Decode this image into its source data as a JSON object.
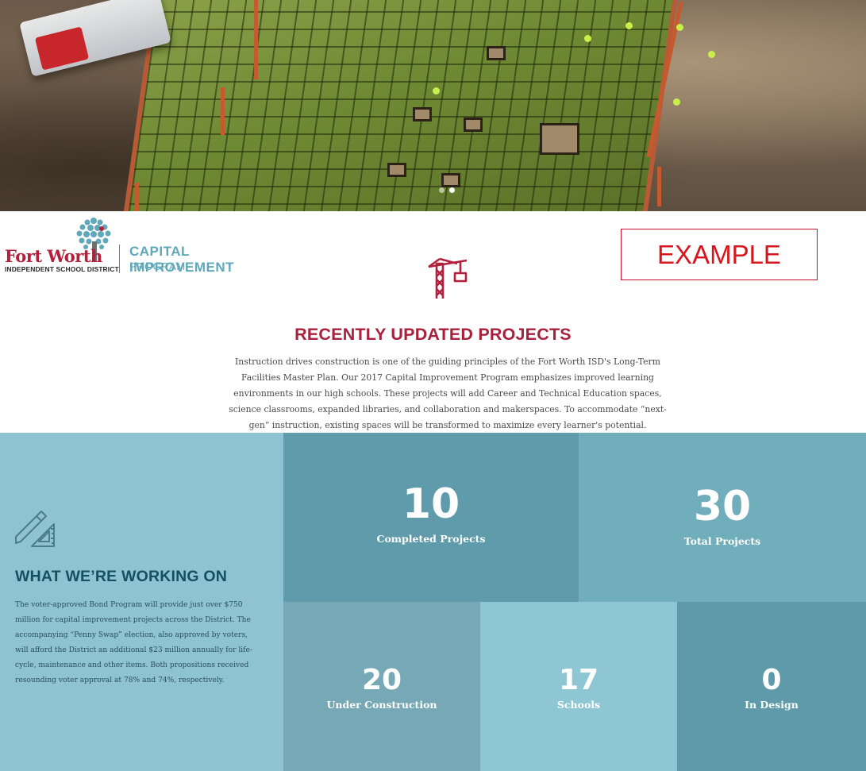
{
  "hero": {
    "image_icon": "construction-site-aerial-photo",
    "slide_count": 2,
    "active_slide": 2
  },
  "logo": {
    "district_name": "Fort Worth",
    "district_subtitle": "INDEPENDENT SCHOOL DISTRICT",
    "program_title": "CAPITAL IMPROVEMENT",
    "program_subtitle": "PROGRAM",
    "tree_icon": "tree-icon"
  },
  "example_label": "EXAMPLE",
  "recent": {
    "icon": "crane-icon",
    "title": "RECENTLY UPDATED PROJECTS",
    "description": "Instruction drives construction is one of the guiding principles of the Fort Worth ISD's Long-Term Facilities Master Plan. Our 2017 Capital Improvement Program emphasizes improved learning environments in our high schools. These projects will add Career and Technical Education spaces, science classrooms, expanded libraries, and collaboration and makerspaces. To accommodate “next-gen” instruction, existing spaces will be transformed to maximize every learner's potential."
  },
  "working": {
    "icon": "ruler-pencil-icon",
    "title": "WHAT WE’RE WORKING ON",
    "description": "The voter-approved Bond Program will provide just over $750 million for capital improvement projects across the District. The accompanying “Penny Swap” election, also approved by voters, will afford the District an additional $23 million annually for life-cycle, maintenance and other items. Both propositions received resounding voter approval at 78% and 74%, respectively."
  },
  "stats": {
    "completed": {
      "value": "10",
      "label": "Completed Projects"
    },
    "total": {
      "value": "30",
      "label": "Total Projects"
    },
    "under_construction": {
      "value": "20",
      "label": "Under Construction"
    },
    "schools": {
      "value": "17",
      "label": "Schools"
    },
    "in_design": {
      "value": "0",
      "label": "In Design"
    }
  },
  "colors": {
    "brand_red": "#a8213a",
    "brand_teal": "#5fa8ba",
    "example_red": "#d8141c",
    "panel_light": "#8ec3d1",
    "panel_dark": "#5f9bab"
  }
}
